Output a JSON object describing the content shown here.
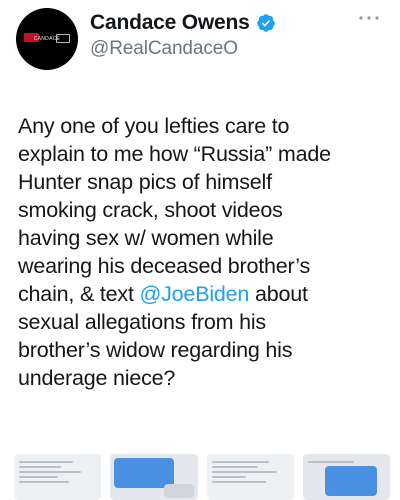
{
  "author": {
    "display_name": "Candace Owens",
    "handle": "@RealCandaceO",
    "avatar_logo_text": "CANDACE",
    "verified": true
  },
  "tweet": {
    "lines": [
      "Any one of you lefties care to",
      "explain to me how “Russia” made",
      "Hunter snap pics of himself",
      "smoking crack, shoot videos",
      "having sex w/ women while",
      "wearing his deceased brother’s",
      "chain, & text ",
      "sexual allegations from his",
      "brother’s widow regarding his",
      "underage niece?"
    ],
    "mention": "@JoeBiden",
    "mention_suffix": " about"
  },
  "icons": {
    "verified": "verified-badge-icon",
    "more": "more-options-icon"
  },
  "colors": {
    "text": "#14171a",
    "secondary": "#657786",
    "accent": "#1da1f2"
  },
  "media": {
    "count": 4
  }
}
